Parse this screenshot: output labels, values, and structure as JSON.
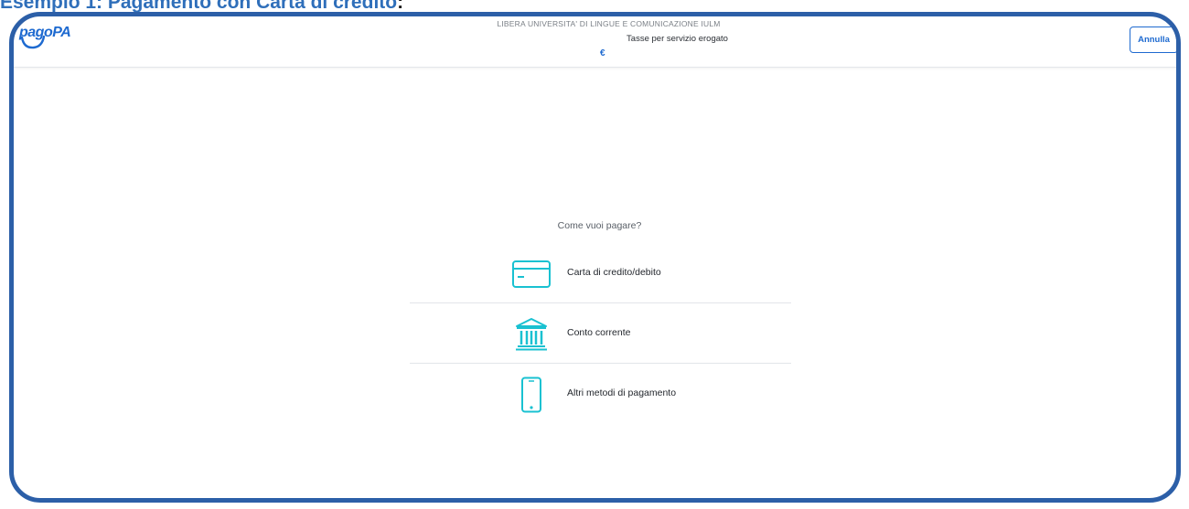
{
  "document": {
    "heading": "Esempio 1: Pagamento con Carta di credito",
    "heading_tail": ":"
  },
  "header": {
    "logo_text": "pagoPA",
    "merchant": "LIBERA UNIVERSITA' DI LINGUE E COMUNICAZIONE IULM",
    "service": "Tasse per servizio erogato",
    "currency": "€",
    "cancel_label": "Annulla"
  },
  "main": {
    "question": "Come vuoi pagare?",
    "methods": [
      {
        "label": "Carta di credito/debito",
        "icon": "credit-card-icon"
      },
      {
        "label": "Conto corrente",
        "icon": "bank-icon"
      },
      {
        "label": "Altri metodi di pagamento",
        "icon": "smartphone-icon"
      }
    ]
  },
  "colors": {
    "frame": "#2c5fa8",
    "brand": "#1e6ad0",
    "icon": "#19c1d1",
    "heading": "#2f6fba"
  }
}
